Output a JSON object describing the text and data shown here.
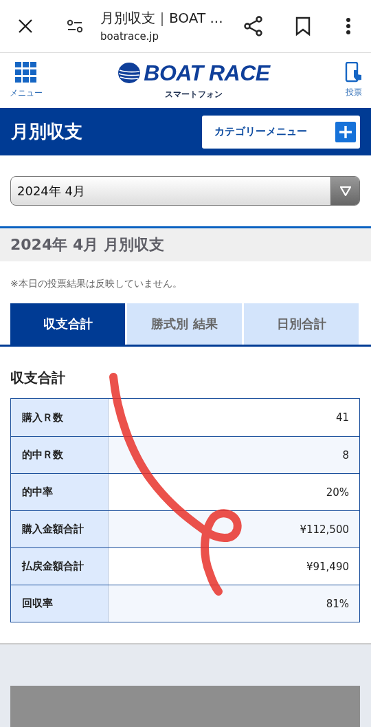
{
  "browser": {
    "title": "月別収支｜BOAT ...",
    "url": "boatrace.jp"
  },
  "header": {
    "menu_label": "メニュー",
    "logo_text": "BOAT RACE",
    "logo_sub": "スマートフォン",
    "vote_label": "投票"
  },
  "page_title": "月別収支",
  "category_button": "カテゴリーメニュー",
  "month_select": {
    "value": "2024年 4月"
  },
  "section_title": "2024年 4月 月別収支",
  "note": "※本日の投票結果は反映していません。",
  "tabs": [
    {
      "label": "収支合計",
      "selected": true
    },
    {
      "label": "勝式別 結果",
      "selected": false
    },
    {
      "label": "日別合計",
      "selected": false
    }
  ],
  "table_title": "収支合計",
  "rows": [
    {
      "label": "購入Ｒ数",
      "value": "41"
    },
    {
      "label": "的中Ｒ数",
      "value": "8"
    },
    {
      "label": "的中率",
      "value": "20%"
    },
    {
      "label": "購入金額合計",
      "value": "¥112,500"
    },
    {
      "label": "払戻金額合計",
      "value": "¥91,490"
    },
    {
      "label": "回収率",
      "value": "81%"
    }
  ]
}
